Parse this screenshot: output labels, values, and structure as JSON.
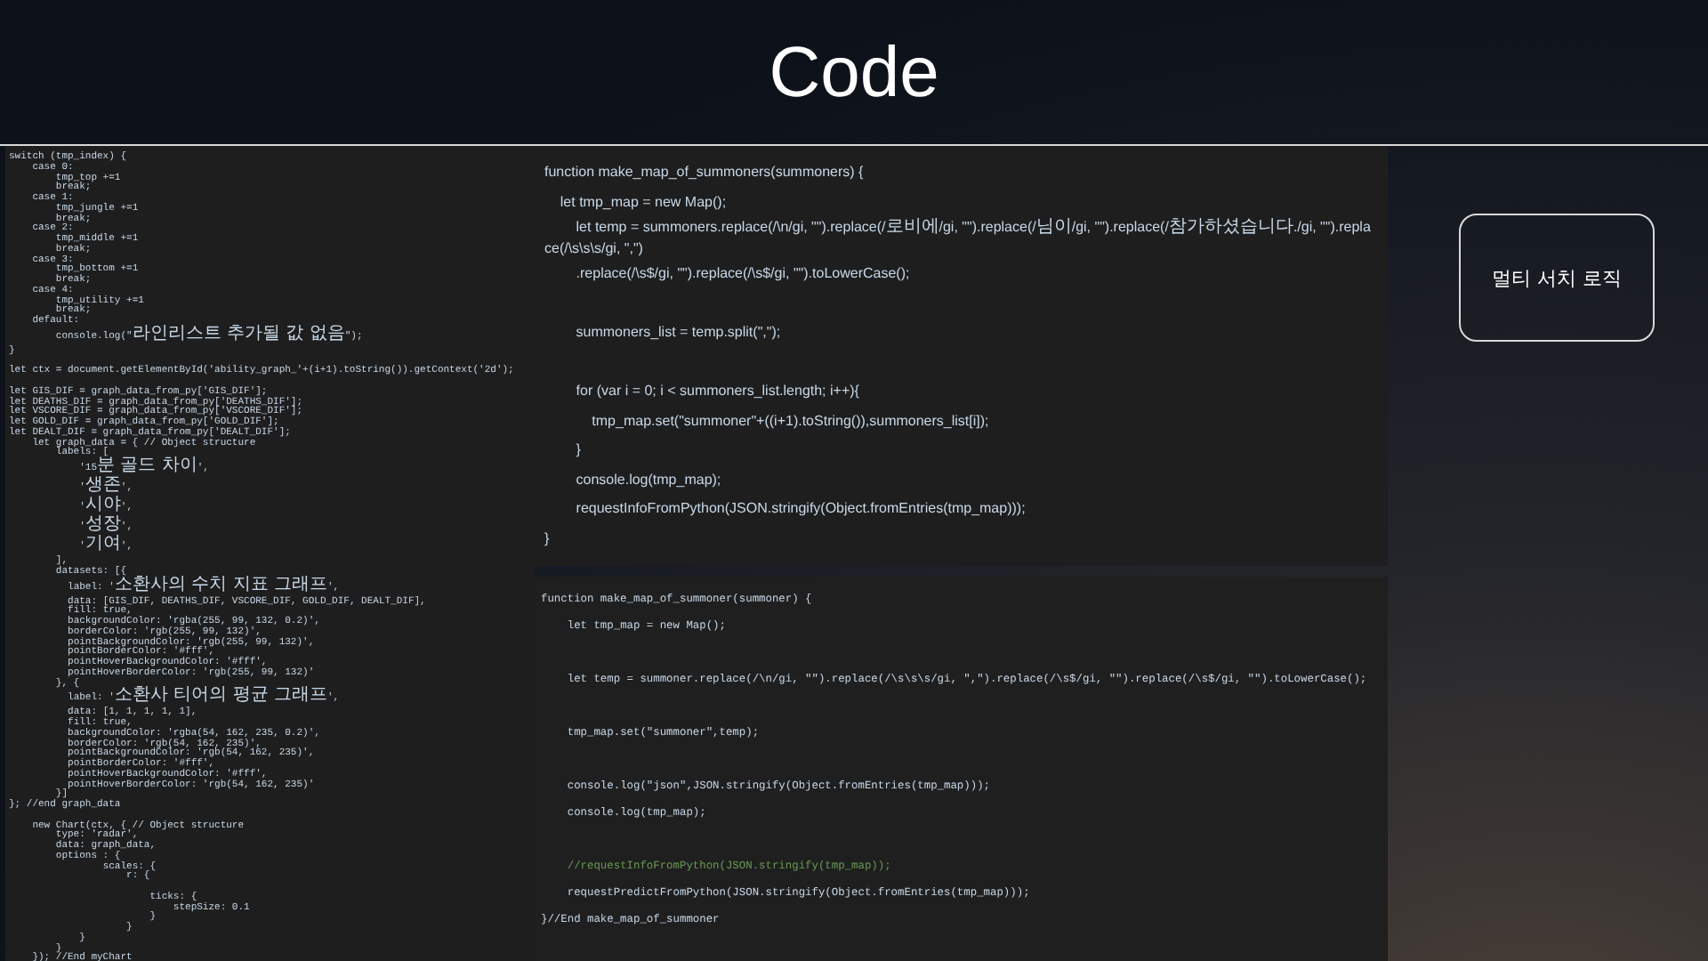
{
  "slide": {
    "title": "Code"
  },
  "left_code": {
    "lines": [
      {
        "kind": "code",
        "text": "switch (tmp_index) {"
      },
      {
        "kind": "code",
        "text": "    case 0:"
      },
      {
        "kind": "code",
        "text": "        tmp_top +=1"
      },
      {
        "kind": "code",
        "text": "        break;"
      },
      {
        "kind": "code",
        "text": "    case 1:"
      },
      {
        "kind": "code",
        "text": "        tmp_jungle +=1"
      },
      {
        "kind": "code",
        "text": "        break;"
      },
      {
        "kind": "code",
        "text": "    case 2:"
      },
      {
        "kind": "code",
        "text": "        tmp_middle +=1"
      },
      {
        "kind": "code",
        "text": "        break;"
      },
      {
        "kind": "code",
        "text": "    case 3:"
      },
      {
        "kind": "code",
        "text": "        tmp_bottom +=1"
      },
      {
        "kind": "code",
        "text": "        break;"
      },
      {
        "kind": "code",
        "text": "    case 4:"
      },
      {
        "kind": "code",
        "text": "        tmp_utility +=1"
      },
      {
        "kind": "code",
        "text": "        break;"
      },
      {
        "kind": "code",
        "text": "    default:"
      },
      {
        "kind": "code",
        "text": "        console.log(\"라인리스트 추가될 값 없음\");"
      },
      {
        "kind": "code",
        "text": "}"
      },
      {
        "kind": "blank"
      },
      {
        "kind": "code",
        "text": "let ctx = document.getElementById('ability_graph_'+(i+1).toString()).getContext('2d');"
      },
      {
        "kind": "blank"
      },
      {
        "kind": "code",
        "text": "let GIS_DIF = graph_data_from_py['GIS_DIF'];"
      },
      {
        "kind": "code",
        "text": "let DEATHS_DIF = graph_data_from_py['DEATHS_DIF'];"
      },
      {
        "kind": "code",
        "text": "let VSCORE_DIF = graph_data_from_py['VSCORE_DIF'];"
      },
      {
        "kind": "code",
        "text": "let GOLD_DIF = graph_data_from_py['GOLD_DIF'];"
      },
      {
        "kind": "code",
        "text": "let DEALT_DIF = graph_data_from_py['DEALT_DIF'];"
      },
      {
        "kind": "code",
        "text": "    let graph_data = { // Object structure"
      },
      {
        "kind": "code",
        "text": "        labels: ["
      },
      {
        "kind": "code",
        "text": "            '15분 골드 차이',"
      },
      {
        "kind": "code",
        "text": "            '생존',"
      },
      {
        "kind": "code",
        "text": "            '시야',"
      },
      {
        "kind": "code",
        "text": "            '성장',"
      },
      {
        "kind": "code",
        "text": "            '기여',"
      },
      {
        "kind": "code",
        "text": "        ],"
      },
      {
        "kind": "code",
        "text": "        datasets: [{"
      },
      {
        "kind": "code",
        "text": "          label: '소환사의 수치 지표 그래프',"
      },
      {
        "kind": "code",
        "text": "          data: [GIS_DIF, DEATHS_DIF, VSCORE_DIF, GOLD_DIF, DEALT_DIF],"
      },
      {
        "kind": "code",
        "text": "          fill: true,"
      },
      {
        "kind": "code",
        "text": "          backgroundColor: 'rgba(255, 99, 132, 0.2)',"
      },
      {
        "kind": "code",
        "text": "          borderColor: 'rgb(255, 99, 132)',"
      },
      {
        "kind": "code",
        "text": "          pointBackgroundColor: 'rgb(255, 99, 132)',"
      },
      {
        "kind": "code",
        "text": "          pointBorderColor: '#fff',"
      },
      {
        "kind": "code",
        "text": "          pointHoverBackgroundColor: '#fff',"
      },
      {
        "kind": "code",
        "text": "          pointHoverBorderColor: 'rgb(255, 99, 132)'"
      },
      {
        "kind": "code",
        "text": "        }, {"
      },
      {
        "kind": "code",
        "text": "          label: '소환사 티어의 평균 그래프',"
      },
      {
        "kind": "code",
        "text": "          data: [1, 1, 1, 1, 1],"
      },
      {
        "kind": "code",
        "text": "          fill: true,"
      },
      {
        "kind": "code",
        "text": "          backgroundColor: 'rgba(54, 162, 235, 0.2)',"
      },
      {
        "kind": "code",
        "text": "          borderColor: 'rgb(54, 162, 235)',"
      },
      {
        "kind": "code",
        "text": "          pointBackgroundColor: 'rgb(54, 162, 235)',"
      },
      {
        "kind": "code",
        "text": "          pointBorderColor: '#fff',"
      },
      {
        "kind": "code",
        "text": "          pointHoverBackgroundColor: '#fff',"
      },
      {
        "kind": "code",
        "text": "          pointHoverBorderColor: 'rgb(54, 162, 235)'"
      },
      {
        "kind": "code",
        "text": "        }]"
      },
      {
        "kind": "code",
        "text": "}; //end graph_data"
      },
      {
        "kind": "blank"
      },
      {
        "kind": "code",
        "text": "    new Chart(ctx, { // Object structure"
      },
      {
        "kind": "code",
        "text": "        type: 'radar',"
      },
      {
        "kind": "code",
        "text": "        data: graph_data,"
      },
      {
        "kind": "code",
        "text": "        options : {"
      },
      {
        "kind": "code",
        "text": "                scales: {"
      },
      {
        "kind": "code",
        "text": "                    r: {"
      },
      {
        "kind": "blank"
      },
      {
        "kind": "code",
        "text": "                        ticks: {"
      },
      {
        "kind": "code",
        "text": "                            stepSize: 0.1"
      },
      {
        "kind": "code",
        "text": "                        }"
      },
      {
        "kind": "code",
        "text": "                    }"
      },
      {
        "kind": "code",
        "text": "            }"
      },
      {
        "kind": "code",
        "text": "        }"
      },
      {
        "kind": "code",
        "text": "    }); //End myChart"
      }
    ]
  },
  "top_code": {
    "lines": [
      {
        "kind": "code",
        "text": "function make_map_of_summoners(summoners) {"
      },
      {
        "kind": "code",
        "text": "    let tmp_map = new Map();"
      },
      {
        "kind": "code",
        "text": "        let temp = summoners.replace(/\\n/gi, \"\").replace(/로비에/gi, \"\").replace(/님이/gi, \"\").replace(/참가하셨습니다./gi, \"\").replace(/\\s\\s\\s/gi, \",\")"
      },
      {
        "kind": "code",
        "text": "        .replace(/\\s$/gi, \"\").replace(/\\s$/gi, \"\").toLowerCase();"
      },
      {
        "kind": "blank"
      },
      {
        "kind": "code",
        "text": "        summoners_list = temp.split(\",\");"
      },
      {
        "kind": "blank"
      },
      {
        "kind": "code",
        "text": "        for (var i = 0; i < summoners_list.length; i++){"
      },
      {
        "kind": "code",
        "text": "            tmp_map.set(\"summoner\"+((i+1).toString()),summoners_list[i]);"
      },
      {
        "kind": "code",
        "text": "        }"
      },
      {
        "kind": "code",
        "text": "        console.log(tmp_map);"
      },
      {
        "kind": "code",
        "text": "        requestInfoFromPython(JSON.stringify(Object.fromEntries(tmp_map)));"
      },
      {
        "kind": "code",
        "text": "}"
      }
    ]
  },
  "bottom_code": {
    "lines": [
      {
        "kind": "code",
        "text": "function make_map_of_summoner(summoner) {"
      },
      {
        "kind": "code",
        "text": "    let tmp_map = new Map();"
      },
      {
        "kind": "blank"
      },
      {
        "kind": "code",
        "text": "    let temp = summoner.replace(/\\n/gi, \"\").replace(/\\s\\s\\s/gi, \",\").replace(/\\s$/gi, \"\").replace(/\\s$/gi, \"\").toLowerCase();"
      },
      {
        "kind": "blank"
      },
      {
        "kind": "code",
        "text": "    tmp_map.set(\"summoner\",temp);"
      },
      {
        "kind": "blank"
      },
      {
        "kind": "code",
        "text": "    console.log(\"json\",JSON.stringify(Object.fromEntries(tmp_map)));"
      },
      {
        "kind": "code",
        "text": "    console.log(tmp_map);"
      },
      {
        "kind": "blank"
      },
      {
        "kind": "comment",
        "text": "    //requestInfoFromPython(JSON.stringify(tmp_map));"
      },
      {
        "kind": "code",
        "text": "    requestPredictFromPython(JSON.stringify(Object.fromEntries(tmp_map)));"
      },
      {
        "kind": "code",
        "text": "}//End make_map_of_summoner"
      }
    ]
  },
  "label_box": {
    "text": "멀티 서치 로직"
  }
}
